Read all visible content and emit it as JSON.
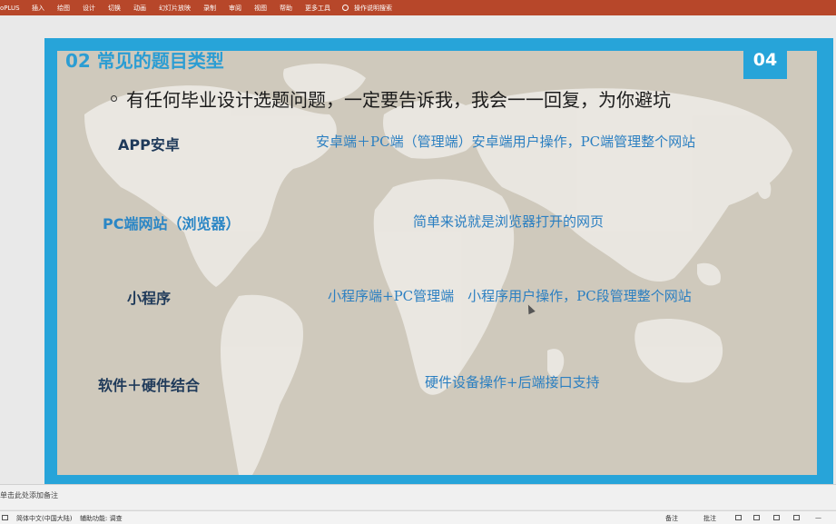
{
  "ribbon": {
    "app_label": "oPLUS",
    "tabs": [
      "插入",
      "绘图",
      "设计",
      "切换",
      "动画",
      "幻灯片放映",
      "录制",
      "审阅",
      "视图",
      "帮助",
      "更多工具"
    ],
    "search_label": "操作说明搜索"
  },
  "slide": {
    "number": "04",
    "title": "02 常见的题目类型",
    "bullet": "有任何毕业设计选题问题，一定要告诉我，我会一一回复，为你避坑",
    "rows": [
      {
        "label": "APP安卓",
        "desc": "安卓端＋PC端（管理端）安卓端用户操作，PC端管理整个网站"
      },
      {
        "label": "PC端网站（浏览器）",
        "desc": "简单来说就是浏览器打开的网页"
      },
      {
        "label": "小程序",
        "desc": "小程序端+PC管理端　小程序用户操作，PC段管理整个网站"
      },
      {
        "label": "软件＋硬件结合",
        "desc": "硬件设备操作+后端接口支持"
      }
    ]
  },
  "notes": {
    "placeholder": "单击此处添加备注"
  },
  "status": {
    "language": "简体中文(中国大陆)",
    "accessibility": "辅助功能: 调查",
    "notes_btn": "备注",
    "comments_btn": "批注"
  },
  "colors": {
    "ribbon": "#b7472a",
    "slide_frame": "#27a4d9",
    "title": "#2b9dd3",
    "desc": "#2b7fc1"
  }
}
